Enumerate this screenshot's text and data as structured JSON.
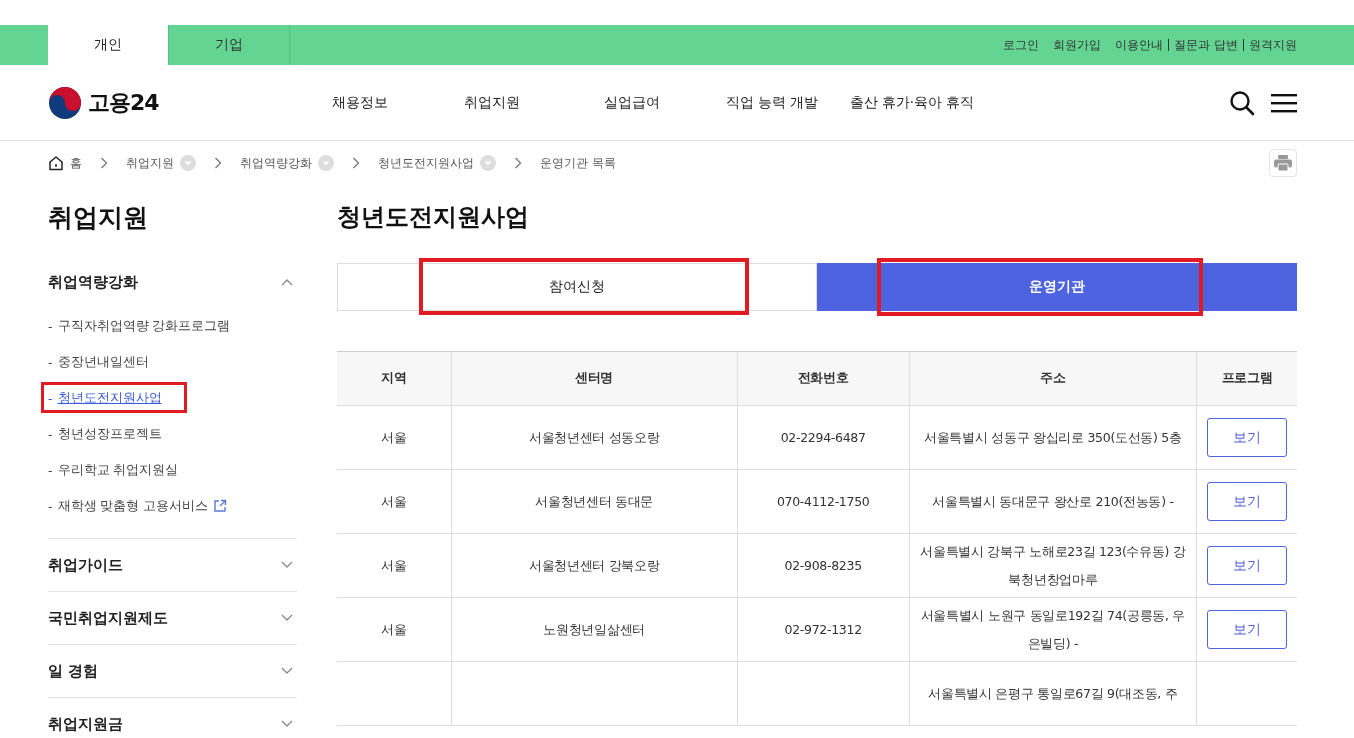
{
  "top_bar": {
    "tabs": [
      {
        "label": "개인",
        "selected": true
      },
      {
        "label": "기업",
        "selected": false
      }
    ],
    "links": [
      {
        "label": "로그인",
        "kind": "link"
      },
      {
        "label": "회원가입",
        "kind": "link"
      },
      {
        "label": "이용안내",
        "kind": "piped"
      },
      {
        "label": "질문과 답변",
        "kind": "piped"
      },
      {
        "label": "원격지원",
        "kind": "piped"
      }
    ]
  },
  "header": {
    "logo": "고용24",
    "nav": [
      "채용정보",
      "취업지원",
      "실업급여",
      "직업 능력 개발",
      "출산 휴가·육아 휴직"
    ]
  },
  "breadcrumb": [
    {
      "label": "홈",
      "kind": "home"
    },
    {
      "label": "취업지원",
      "kind": "dropdown"
    },
    {
      "label": "취업역량강화",
      "kind": "dropdown"
    },
    {
      "label": "청년도전지원사업",
      "kind": "dropdown"
    },
    {
      "label": "운영기관 목록",
      "kind": "current"
    }
  ],
  "sidebar": {
    "title": "취업지원",
    "groups": [
      {
        "label": "취업역량강화",
        "expanded": true,
        "children": [
          {
            "prefix": "-",
            "label": "구직자취업역량 강화프로그램",
            "selected": false,
            "highlighted": false,
            "external": false
          },
          {
            "prefix": "-",
            "label": "중장년내일센터",
            "selected": false,
            "highlighted": false,
            "external": false
          },
          {
            "prefix": "-",
            "label": "청년도전지원사업",
            "selected": true,
            "highlighted": true,
            "external": false
          },
          {
            "prefix": "-",
            "label": "청년성장프로젝트",
            "selected": false,
            "highlighted": false,
            "external": false
          },
          {
            "prefix": "-",
            "label": "우리학교 취업지원실",
            "selected": false,
            "highlighted": false,
            "external": false
          },
          {
            "prefix": "-",
            "label": "재학생 맞춤형 고용서비스",
            "selected": false,
            "highlighted": false,
            "external": true
          }
        ]
      },
      {
        "label": "취업가이드",
        "expanded": false
      },
      {
        "label": "국민취업지원제도",
        "expanded": false
      },
      {
        "label": "일 경험",
        "expanded": false
      },
      {
        "label": "취업지원금",
        "expanded": false
      }
    ]
  },
  "page_title": "청년도전지원사업",
  "tabs": [
    {
      "label": "참여신청",
      "selected": false,
      "highlighted": true
    },
    {
      "label": "운영기관",
      "selected": true,
      "highlighted": true
    }
  ],
  "table": {
    "columns": [
      "지역",
      "센터명",
      "전화번호",
      "주소",
      "프로그램"
    ],
    "rows": [
      {
        "region": "서울",
        "center": "서울청년센터 성동오랑",
        "phone": "02-2294-6487",
        "address": "서울특별시 성동구 왕십리로 350(도선동) 5층",
        "button": "보기"
      },
      {
        "region": "서울",
        "center": "서울청년센터 동대문",
        "phone": "070-4112-1750",
        "address": "서울특별시 동대문구 왕산로 210(전농동) -",
        "button": "보기"
      },
      {
        "region": "서울",
        "center": "서울청년센터 강북오랑",
        "phone": "02-908-8235",
        "address": "서울특별시 강북구 노해로23길 123(수유동) 강북청년창업마루",
        "button": "보기"
      },
      {
        "region": "서울",
        "center": "노원청년일삶센터",
        "phone": "02-972-1312",
        "address": "서울특별시 노원구 동일로192길 74(공릉동, 우은빌딩) -",
        "button": "보기"
      },
      {
        "address": "서울특별시 은평구 통일로67길 9(대조동, 주"
      }
    ]
  }
}
